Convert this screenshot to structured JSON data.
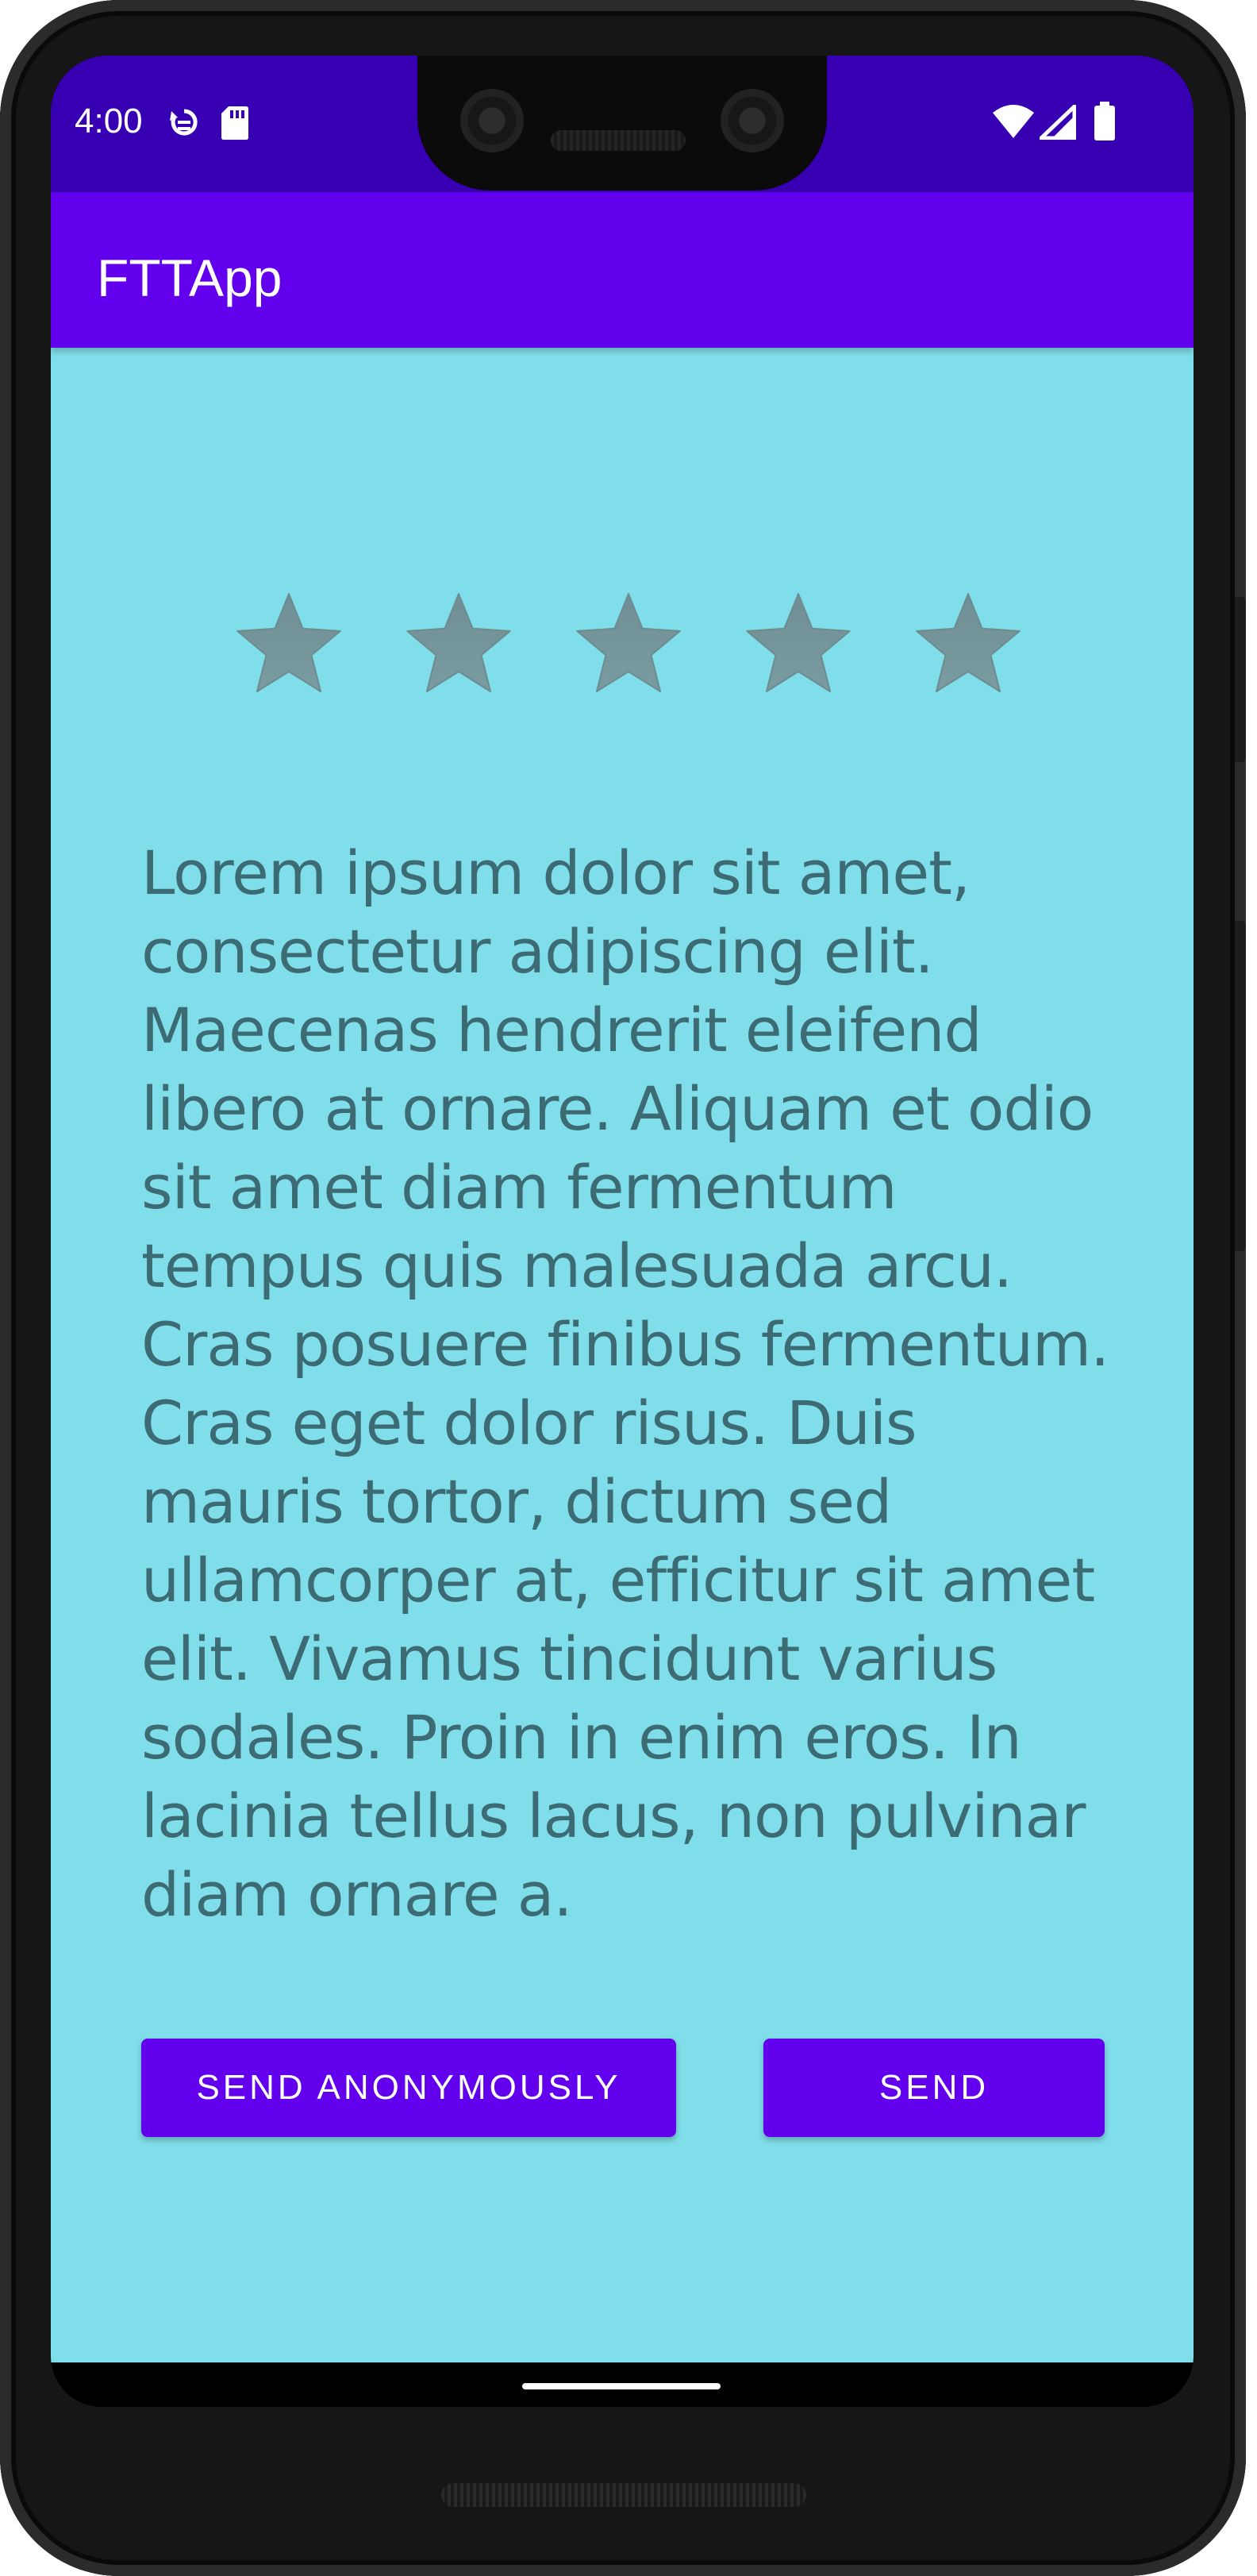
{
  "status_bar": {
    "time": "4:00",
    "icons": [
      "sync-icon",
      "sd-card-icon",
      "wifi-icon",
      "signal-icon",
      "battery-icon"
    ]
  },
  "app_bar": {
    "title": "FTTApp"
  },
  "rating": {
    "max_stars": 5,
    "selected": 0,
    "star_color": "#7a9ba0"
  },
  "feedback": {
    "text": "Lorem ipsum dolor sit amet, consectetur adipiscing elit. Maecenas hendrerit eleifend libero at ornare. Aliquam et odio sit amet diam fermentum tempus quis malesuada arcu. Cras posuere finibus fermentum. Cras eget dolor risus. Duis mauris tortor, dictum sed ullamcorper at, efficitur sit amet elit. Vivamus tincidunt varius sodales. Proin in enim eros. In lacinia tellus lacus, non pulvinar diam ornare a."
  },
  "actions": {
    "send_anonymously_label": "SEND ANONYMOUSLY",
    "send_label": "SEND"
  },
  "colors": {
    "status_bar": "#3700b3",
    "app_bar": "#6200ee",
    "background": "#80deea",
    "text": "#3d6b74",
    "button": "#6200ee"
  }
}
